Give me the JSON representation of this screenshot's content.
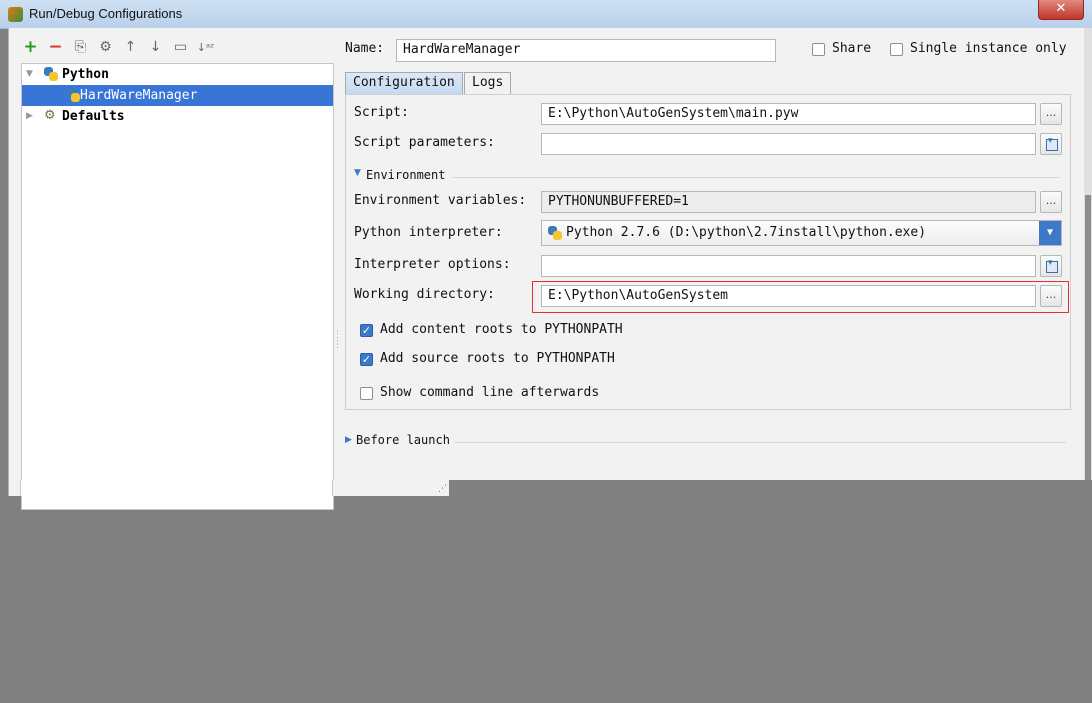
{
  "window": {
    "title": "Run/Debug Configurations",
    "close_glyph": "✕"
  },
  "toolbar": {
    "add": "+",
    "remove": "−",
    "copy": "⎘",
    "edit_defaults": "⚙",
    "move_up": "↑",
    "move_down": "↓",
    "folder": "▭",
    "sort": "↓ᵃᶻ"
  },
  "tree": {
    "python_label": "Python",
    "config_label": "HardWareManager",
    "defaults_label": "Defaults"
  },
  "header": {
    "name_label": "Name:",
    "name_value": "HardWareManager",
    "share_label": "Share",
    "single_instance_label": "Single instance only"
  },
  "tabs": {
    "configuration": "Configuration",
    "logs": "Logs"
  },
  "form": {
    "script_label": "Script:",
    "script_value": "E:\\Python\\AutoGenSystem\\main.pyw",
    "script_params_label": "Script parameters:",
    "script_params_value": "",
    "environment_label": "Environment",
    "env_vars_label": "Environment variables:",
    "env_vars_value": "PYTHONUNBUFFERED=1",
    "interpreter_label": "Python interpreter:",
    "interpreter_value": "Python 2.7.6 (D:\\python\\2.7install\\python.exe)",
    "interp_options_label": "Interpreter options:",
    "interp_options_value": "",
    "working_dir_label": "Working directory:",
    "working_dir_value": "E:\\Python\\AutoGenSystem",
    "dots": "..."
  },
  "checkboxes": {
    "content_roots": "Add content roots to PYTHONPATH",
    "source_roots": "Add source roots to PYTHONPATH",
    "show_cmd": "Show command line afterwards"
  },
  "before_launch_label": "Before launch",
  "colors": {
    "selection": "#3875d7",
    "accent_blue": "#3c79c8",
    "highlight_red": "#e03030"
  }
}
